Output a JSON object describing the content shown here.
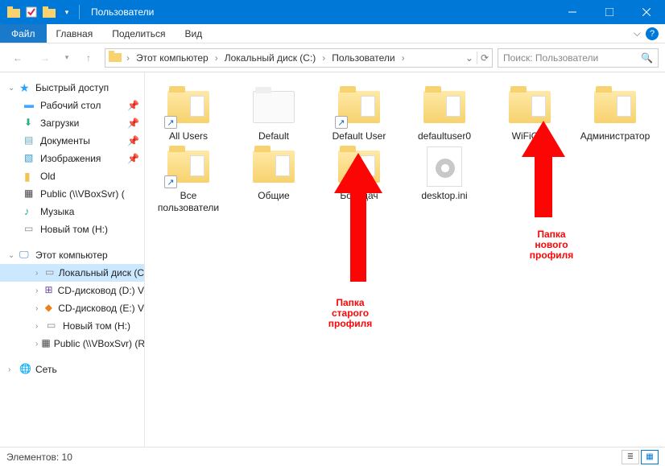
{
  "window": {
    "title": "Пользователи"
  },
  "ribbon": {
    "file": "Файл",
    "tabs": [
      "Главная",
      "Поделиться",
      "Вид"
    ]
  },
  "breadcrumb": {
    "items": [
      "Этот компьютер",
      "Локальный диск (C:)",
      "Пользователи"
    ]
  },
  "search": {
    "placeholder": "Поиск: Пользователи"
  },
  "sidebar": {
    "quick": {
      "label": "Быстрый доступ"
    },
    "quick_items": [
      {
        "label": "Рабочий стол",
        "icon": "ic-desktop",
        "pinned": true
      },
      {
        "label": "Загрузки",
        "icon": "ic-down",
        "pinned": true
      },
      {
        "label": "Документы",
        "icon": "ic-doc",
        "pinned": true
      },
      {
        "label": "Изображения",
        "icon": "ic-img",
        "pinned": true
      },
      {
        "label": "Old",
        "icon": "ic-fold",
        "pinned": false
      },
      {
        "label": "Public (\\\\VBoxSvr) (",
        "icon": "ic-net",
        "pinned": false
      },
      {
        "label": "Музыка",
        "icon": "ic-music",
        "pinned": false
      },
      {
        "label": "Новый том (H:)",
        "icon": "ic-drive",
        "pinned": false
      }
    ],
    "pc": {
      "label": "Этот компьютер"
    },
    "pc_items": [
      {
        "label": "Локальный диск (C",
        "icon": "ic-drive",
        "selected": true
      },
      {
        "label": "CD-дисковод (D:) V",
        "icon": "ic-win"
      },
      {
        "label": "CD-дисковод (E:) V",
        "icon": "ic-vbox"
      },
      {
        "label": "Новый том (H:)",
        "icon": "ic-drive"
      },
      {
        "label": "Public (\\\\VBoxSvr) (R",
        "icon": "ic-net"
      }
    ],
    "network": {
      "label": "Сеть"
    }
  },
  "files": [
    {
      "label": "All Users",
      "type": "folder-bars",
      "shortcut": true
    },
    {
      "label": "Default",
      "type": "white-folder"
    },
    {
      "label": "Default User",
      "type": "folder-bars",
      "shortcut": true
    },
    {
      "label": "defaultuser0",
      "type": "folder-bars"
    },
    {
      "label": "WiFiGiD",
      "type": "folder-bars"
    },
    {
      "label": "Администратор",
      "type": "folder-bars"
    },
    {
      "label": "Все пользователи",
      "type": "folder-bars",
      "shortcut": true
    },
    {
      "label": "Общие",
      "type": "folder-bars"
    },
    {
      "label": "Бородач",
      "type": "folder-bars"
    },
    {
      "label": "desktop.ini",
      "type": "ini"
    }
  ],
  "status": {
    "count_label": "Элементов: 10"
  },
  "annotations": {
    "old": {
      "line1": "Папка",
      "line2": "старого",
      "line3": "профиля"
    },
    "new": {
      "line1": "Папка",
      "line2": "нового",
      "line3": "профиля"
    }
  }
}
